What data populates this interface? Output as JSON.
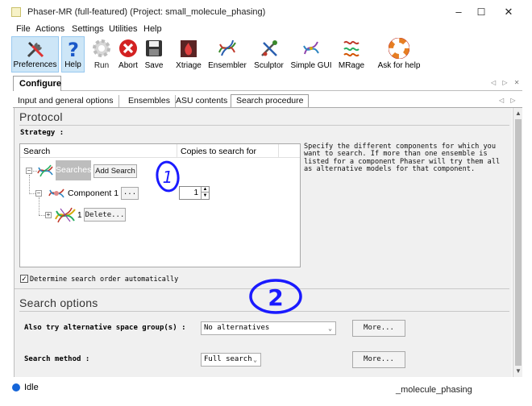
{
  "window": {
    "title": "Phaser-MR (full-featured) (Project: small_molecule_phasing)",
    "controls": {
      "minimize": "–",
      "maximize": "☐",
      "close": "✕"
    }
  },
  "menu": [
    "File",
    "Actions",
    "Settings",
    "Utilities",
    "Help"
  ],
  "toolbar": [
    {
      "label": "Preferences",
      "icon": "wrench-screwdriver-icon"
    },
    {
      "label": "Help",
      "icon": "question-mark-icon"
    },
    {
      "label": "Run",
      "icon": "gear-icon"
    },
    {
      "label": "Abort",
      "icon": "stop-x-icon"
    },
    {
      "label": "Save",
      "icon": "floppy-disk-icon"
    },
    {
      "label": "Xtriage",
      "icon": "xtriage-icon"
    },
    {
      "label": "Ensembler",
      "icon": "ensembler-icon"
    },
    {
      "label": "Sculptor",
      "icon": "sculptor-icon"
    },
    {
      "label": "Simple GUI",
      "icon": "simple-gui-icon"
    },
    {
      "label": "MRage",
      "icon": "mrage-icon"
    },
    {
      "label": "Ask for help",
      "icon": "lifebuoy-icon"
    }
  ],
  "configure_tab": "Configure",
  "subtabs": [
    "Input and general options",
    "Ensembles",
    "ASU contents",
    "Search procedure"
  ],
  "protocol": {
    "title": "Protocol",
    "strategy_label": "Strategy :",
    "columns": [
      "Search",
      "Copies to search for"
    ],
    "tree": {
      "root_label": "Searches",
      "add_search_button": "Add Search",
      "component_label": "Component 1",
      "component_button": "...",
      "copies_value": "1",
      "ensemble_number": "1",
      "delete_button": "Delete..."
    },
    "description": "Specify the different components for which you want to search. If more than one ensemble is listed for a component Phaser will try them all as alternative models for that component.",
    "auto_order": {
      "checked": true,
      "label": "Determine search order automatically"
    }
  },
  "search_options": {
    "title": "Search options",
    "alt_space_group": {
      "label": "Also try alternative space group(s) :",
      "value": "No alternatives",
      "more_button": "More..."
    },
    "search_method": {
      "label": "Search method :",
      "value": "Full search",
      "more_button": "More..."
    }
  },
  "annotations": {
    "mark1": "1",
    "mark2": "2",
    "color": "#1a1aff"
  },
  "status": {
    "state": "Idle",
    "project": "_molecule_phasing"
  }
}
